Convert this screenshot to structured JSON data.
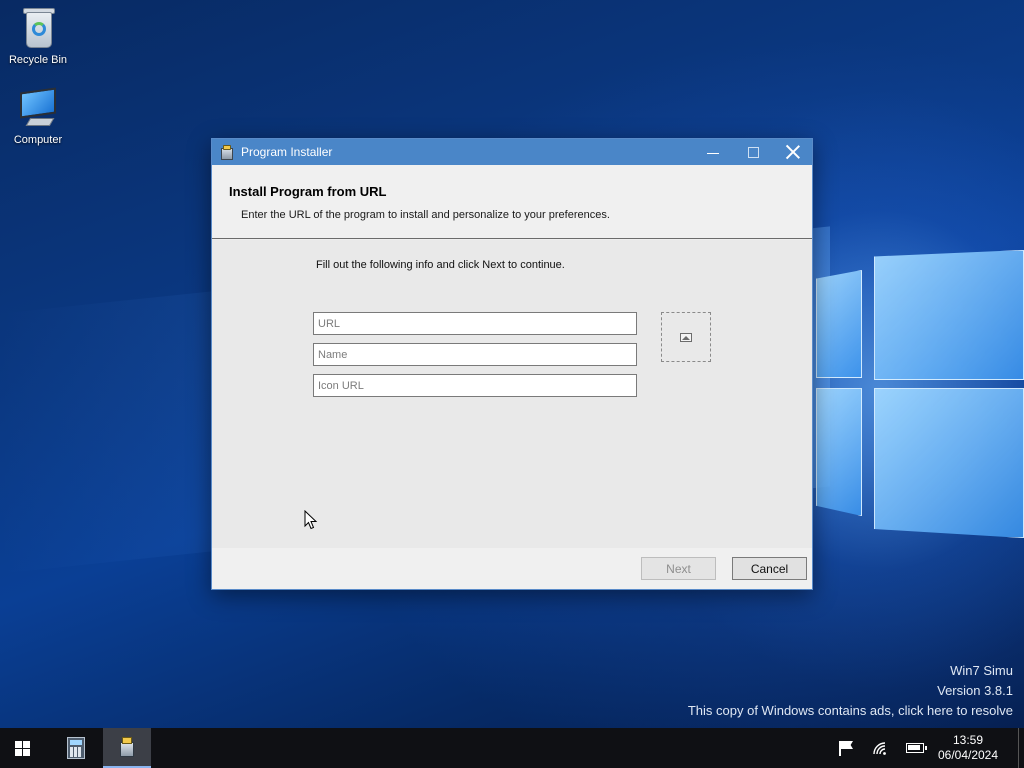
{
  "desktop": {
    "icons": [
      {
        "label": "Recycle Bin",
        "icon": "recycle-bin-icon"
      },
      {
        "label": "Computer",
        "icon": "computer-icon"
      }
    ],
    "watermark": {
      "line1": "Win7 Simu",
      "line2": "Version 3.8.1",
      "line3": "This copy of Windows contains ads, click here to resolve"
    }
  },
  "window": {
    "title": "Program Installer",
    "title_icon": "installer-icon",
    "controls": {
      "minimize": "minimize-icon",
      "maximize": "maximize-icon",
      "close": "close-icon"
    },
    "header": {
      "title": "Install Program from URL",
      "subtitle": "Enter the URL of the program to install and personalize to your preferences."
    },
    "instructions": "Fill out the following info and click Next to continue.",
    "fields": {
      "url": {
        "value": "",
        "placeholder": "URL"
      },
      "name": {
        "value": "",
        "placeholder": "Name"
      },
      "icon_url": {
        "value": "",
        "placeholder": "Icon URL"
      }
    },
    "icon_preview": "image-placeholder-icon",
    "buttons": {
      "next": {
        "label": "Next",
        "enabled": false
      },
      "cancel": {
        "label": "Cancel",
        "enabled": true
      }
    }
  },
  "taskbar": {
    "start": "windows-start-icon",
    "apps": [
      {
        "name": "Calculator",
        "icon": "calculator-icon",
        "active": false
      },
      {
        "name": "Program Installer",
        "icon": "installer-icon",
        "active": true
      }
    ],
    "tray": [
      "flag-icon",
      "wifi-icon",
      "battery-icon"
    ],
    "clock": {
      "time": "13:59",
      "date": "06/04/2024"
    }
  },
  "colors": {
    "titlebar": "#4a86c8",
    "taskbar": "#0f1014",
    "desktop": "#0b3a86"
  }
}
